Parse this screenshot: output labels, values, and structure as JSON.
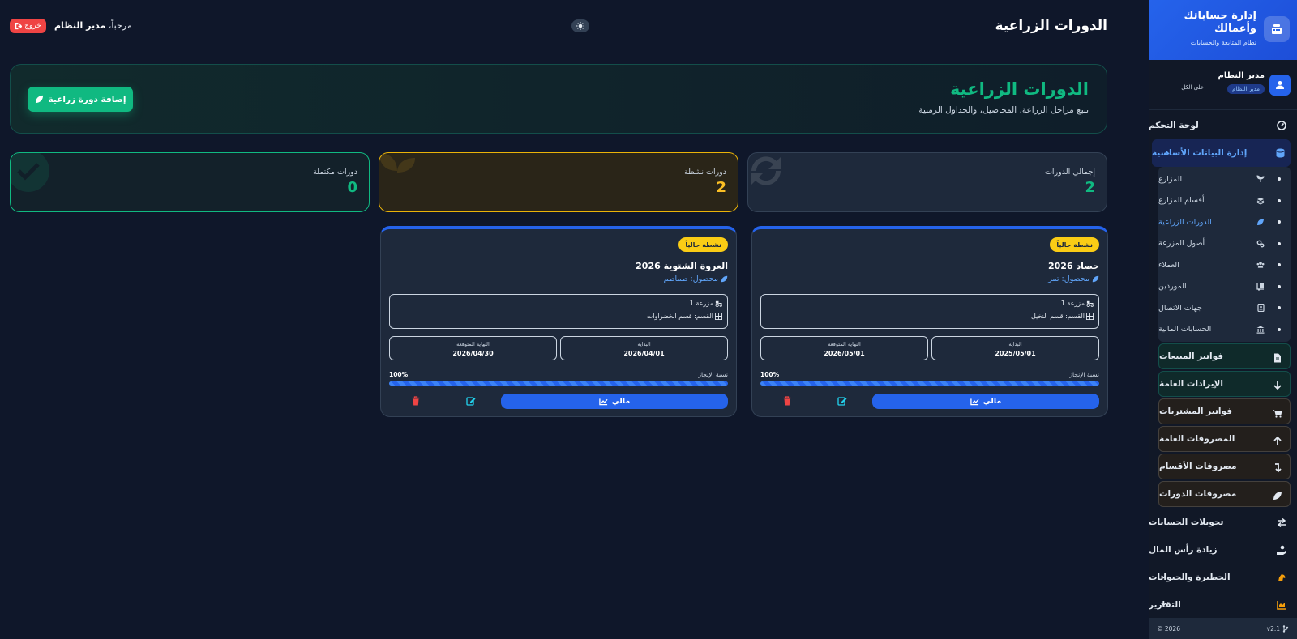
{
  "sidebar": {
    "app_title": "إدارة حساباتك وأعمالك",
    "app_subtitle": "نظام المتابعة والحسابات",
    "user": {
      "name": "مدير النظام",
      "role": "مدير النظام",
      "scope": "على الكل"
    },
    "items": {
      "dashboard": "لوحة التحكم",
      "master_data": "إدارة البيانات الأساسية",
      "farms": "المزارع",
      "farm_sections": "أقسام المزارع",
      "cycles": "الدورات الزراعية",
      "farm_assets": "أصول المزرعة",
      "customers": "العملاء",
      "suppliers": "الموردين",
      "contacts": "جهات الاتصال",
      "accounts": "الحسابات المالية",
      "sales_invoices": "فواتير المبيعات",
      "general_revenues": "الإيرادات العامة",
      "purchase_invoices": "فواتير المشتريات",
      "general_expenses": "المصروفات العامة",
      "section_expenses": "مصروفات الأقسام",
      "cycle_expenses": "مصروفات الدورات",
      "transfers": "تحويلات الحسابات",
      "capital_increase": "زيادة رأس المال",
      "livestock": "الحظيرة والحيوانات",
      "reports": "التقارير"
    },
    "version": "v2.1",
    "copyright": "2026 ©"
  },
  "header": {
    "title": "الدورات الزراعية",
    "welcome": "مرحباً،",
    "user": "مدير النظام",
    "logout": "خروج"
  },
  "hero": {
    "title": "الدورات الزراعية",
    "subtitle": "تتبع مراحل الزراعة، المحاصيل، والجداول الزمنية",
    "add_button": "إضافة دورة زراعية"
  },
  "stats": [
    {
      "label": "إجمالي الدورات",
      "value": "2"
    },
    {
      "label": "دورات نشطة",
      "value": "2"
    },
    {
      "label": "دورات مكتملة",
      "value": "0"
    }
  ],
  "cycles": [
    {
      "status": "نشطة حالياً",
      "name": "حصاد 2026",
      "crop": "محصول: تمر",
      "farm": "مزرعة 1",
      "section": "القسم: قسم النخيل",
      "start_label": "البداية",
      "start": "2025/05/01",
      "end_label": "النهاية المتوقعة",
      "end": "2026/05/01",
      "progress_label": "نسبة الإنجاز",
      "progress": "100%",
      "progress_fraction": 1.0,
      "finance_button": "مالي"
    },
    {
      "status": "نشطة حالياً",
      "name": "العروة الشتوية 2026",
      "crop": "محصول: طماطم",
      "farm": "مزرعة 1",
      "section": "القسم: قسم الخضراوات",
      "start_label": "البداية",
      "start": "2026/04/01",
      "end_label": "النهاية المتوقعة",
      "end": "2026/04/30",
      "progress_label": "نسبة الإنجاز",
      "progress": "100%",
      "progress_fraction": 1.0,
      "finance_button": "مالي"
    }
  ],
  "colors": {
    "accent": "#2563eb",
    "success": "#10b981",
    "warning": "#facc15",
    "danger": "#ef4444",
    "background": "#0f172a"
  }
}
